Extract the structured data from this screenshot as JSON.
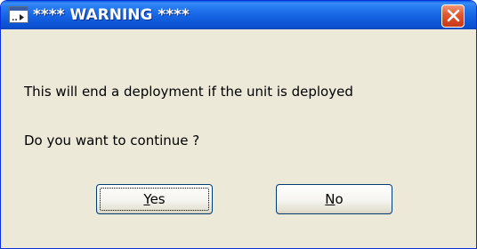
{
  "window": {
    "title": "**** WARNING ****"
  },
  "message": {
    "line1": "This will end a deployment if the unit is deployed",
    "line2": "Do you want to continue ?"
  },
  "buttons": {
    "yes": {
      "mnemonic": "Y",
      "rest": "es"
    },
    "no": {
      "mnemonic": "N",
      "rest": "o"
    }
  },
  "colors": {
    "titlebar": "#0a5ee6",
    "close_button": "#e35b32",
    "dialog_background": "#ece9d8"
  }
}
